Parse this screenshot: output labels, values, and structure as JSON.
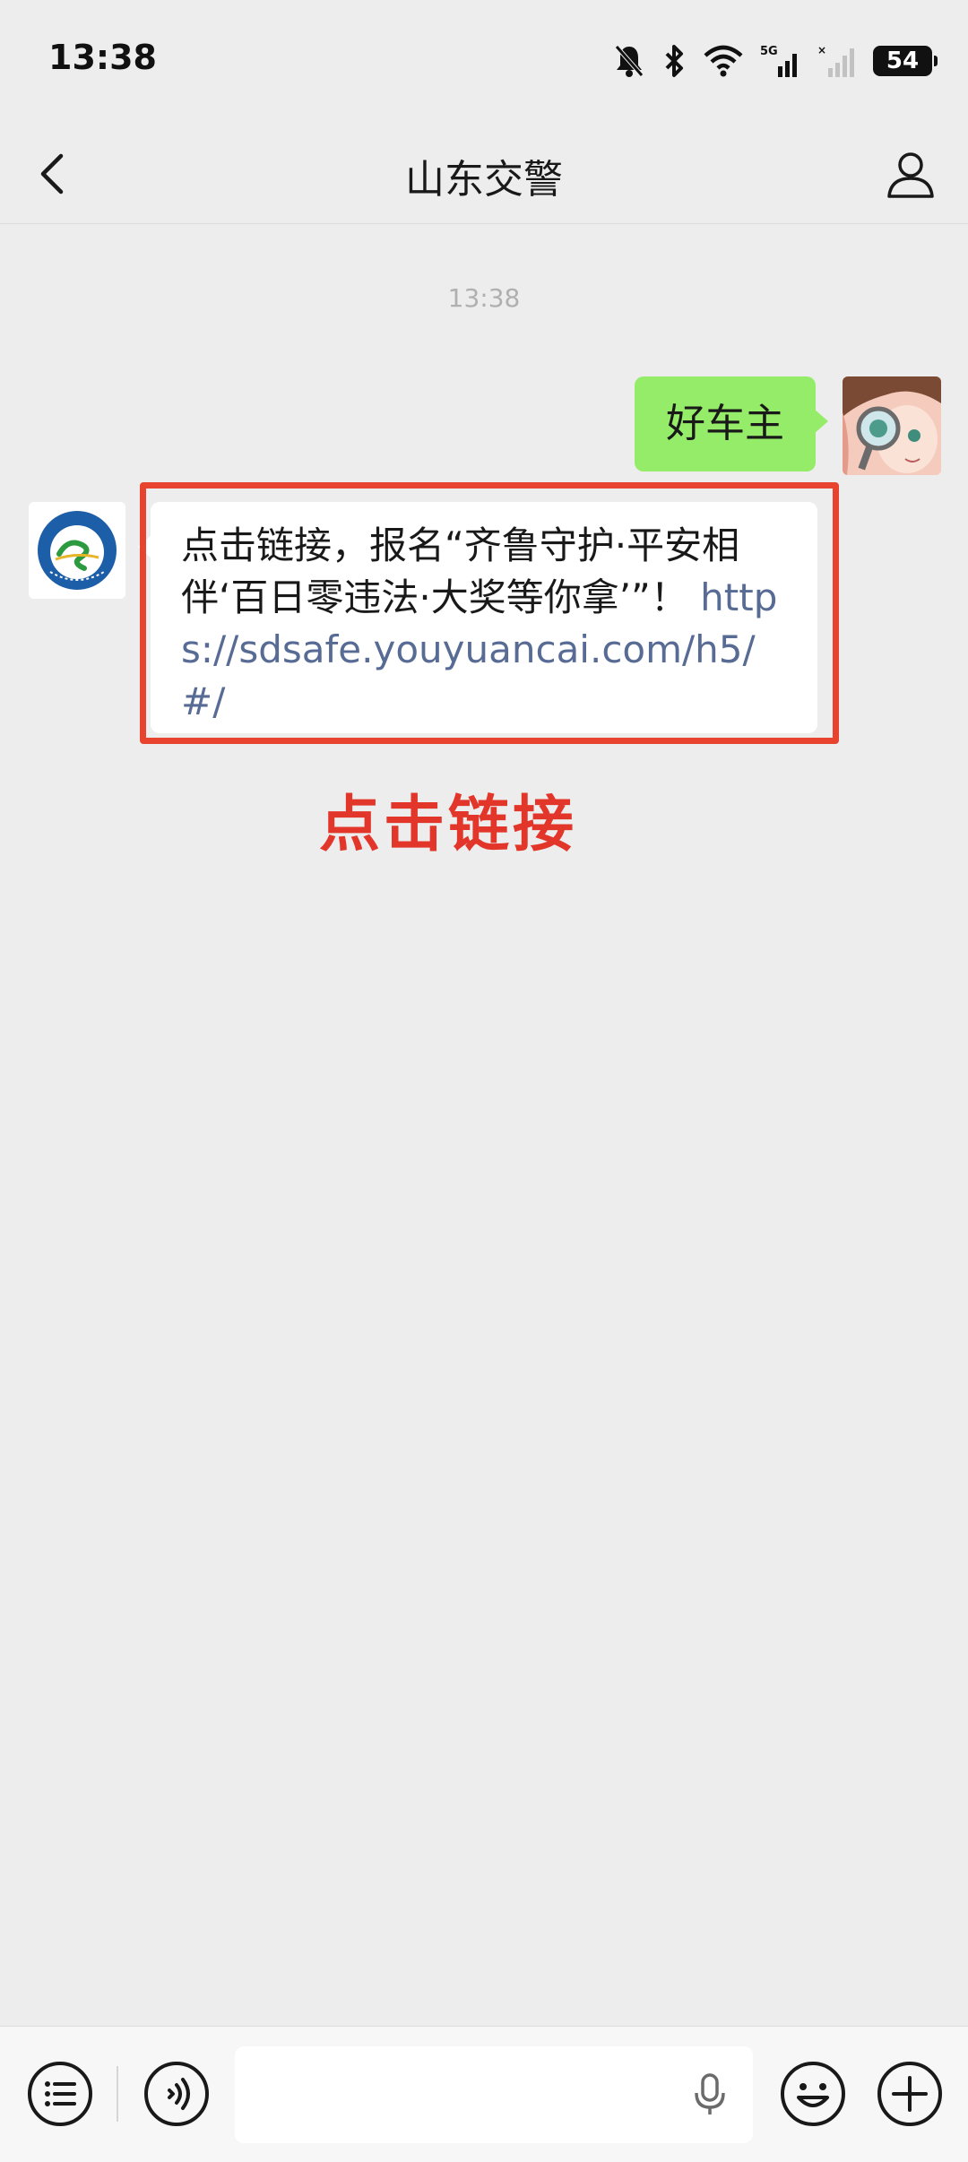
{
  "status_bar": {
    "time": "13:38",
    "battery": "54",
    "network": "5G"
  },
  "nav": {
    "title": "山东交警"
  },
  "chat": {
    "timestamp": "13:38",
    "messages": [
      {
        "sender": "me",
        "text": "好车主"
      },
      {
        "sender": "official",
        "avatar_text": "山东交警",
        "text": "点击链接，报名“齐鲁守护·平安相伴‘百日零违法·大奖等你拿’”！",
        "link": "https://sdsafe.youyuancai.com/h5/#/"
      }
    ],
    "annotation": "点击链接"
  },
  "input_bar": {
    "value": "",
    "placeholder": ""
  },
  "colors": {
    "background": "#ededed",
    "sent_bubble": "#95ec69",
    "received_bubble": "#ffffff",
    "link": "#576b95",
    "highlight": "#e8432e"
  }
}
